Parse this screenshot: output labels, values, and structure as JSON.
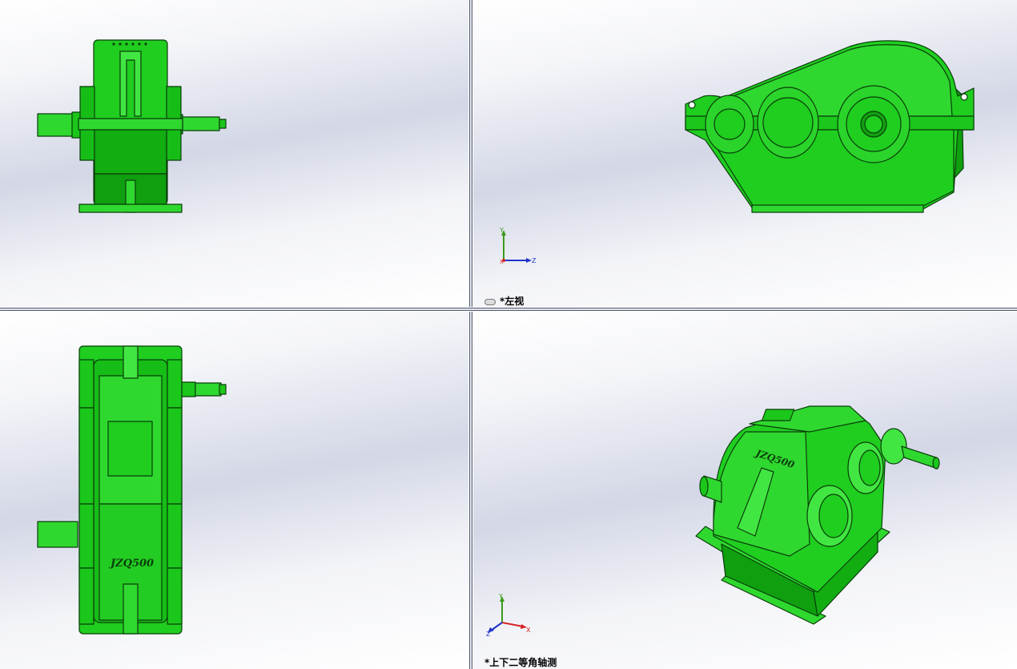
{
  "viewports": {
    "top_left": {
      "view_name": ""
    },
    "top_right": {
      "view_name": "*左视",
      "triad": {
        "up": "Y",
        "right": "Z",
        "origin": "X"
      }
    },
    "bottom_left": {
      "view_name": "",
      "engraving": "JZQ500"
    },
    "bottom_right": {
      "view_name": "*上下二等角轴测",
      "engraving": "JZQ500",
      "triad": {
        "up": "Y",
        "right": "X",
        "left": "Z"
      }
    }
  },
  "colors": {
    "body": "#1fce1f",
    "body_light": "#42e642",
    "body_dark": "#0a9a0a",
    "edge": "#0b3d0b",
    "axis_x": "#d42222",
    "axis_y": "#3a9a1a",
    "axis_z": "#2233cc"
  },
  "icons": [
    "cursor-icon"
  ]
}
